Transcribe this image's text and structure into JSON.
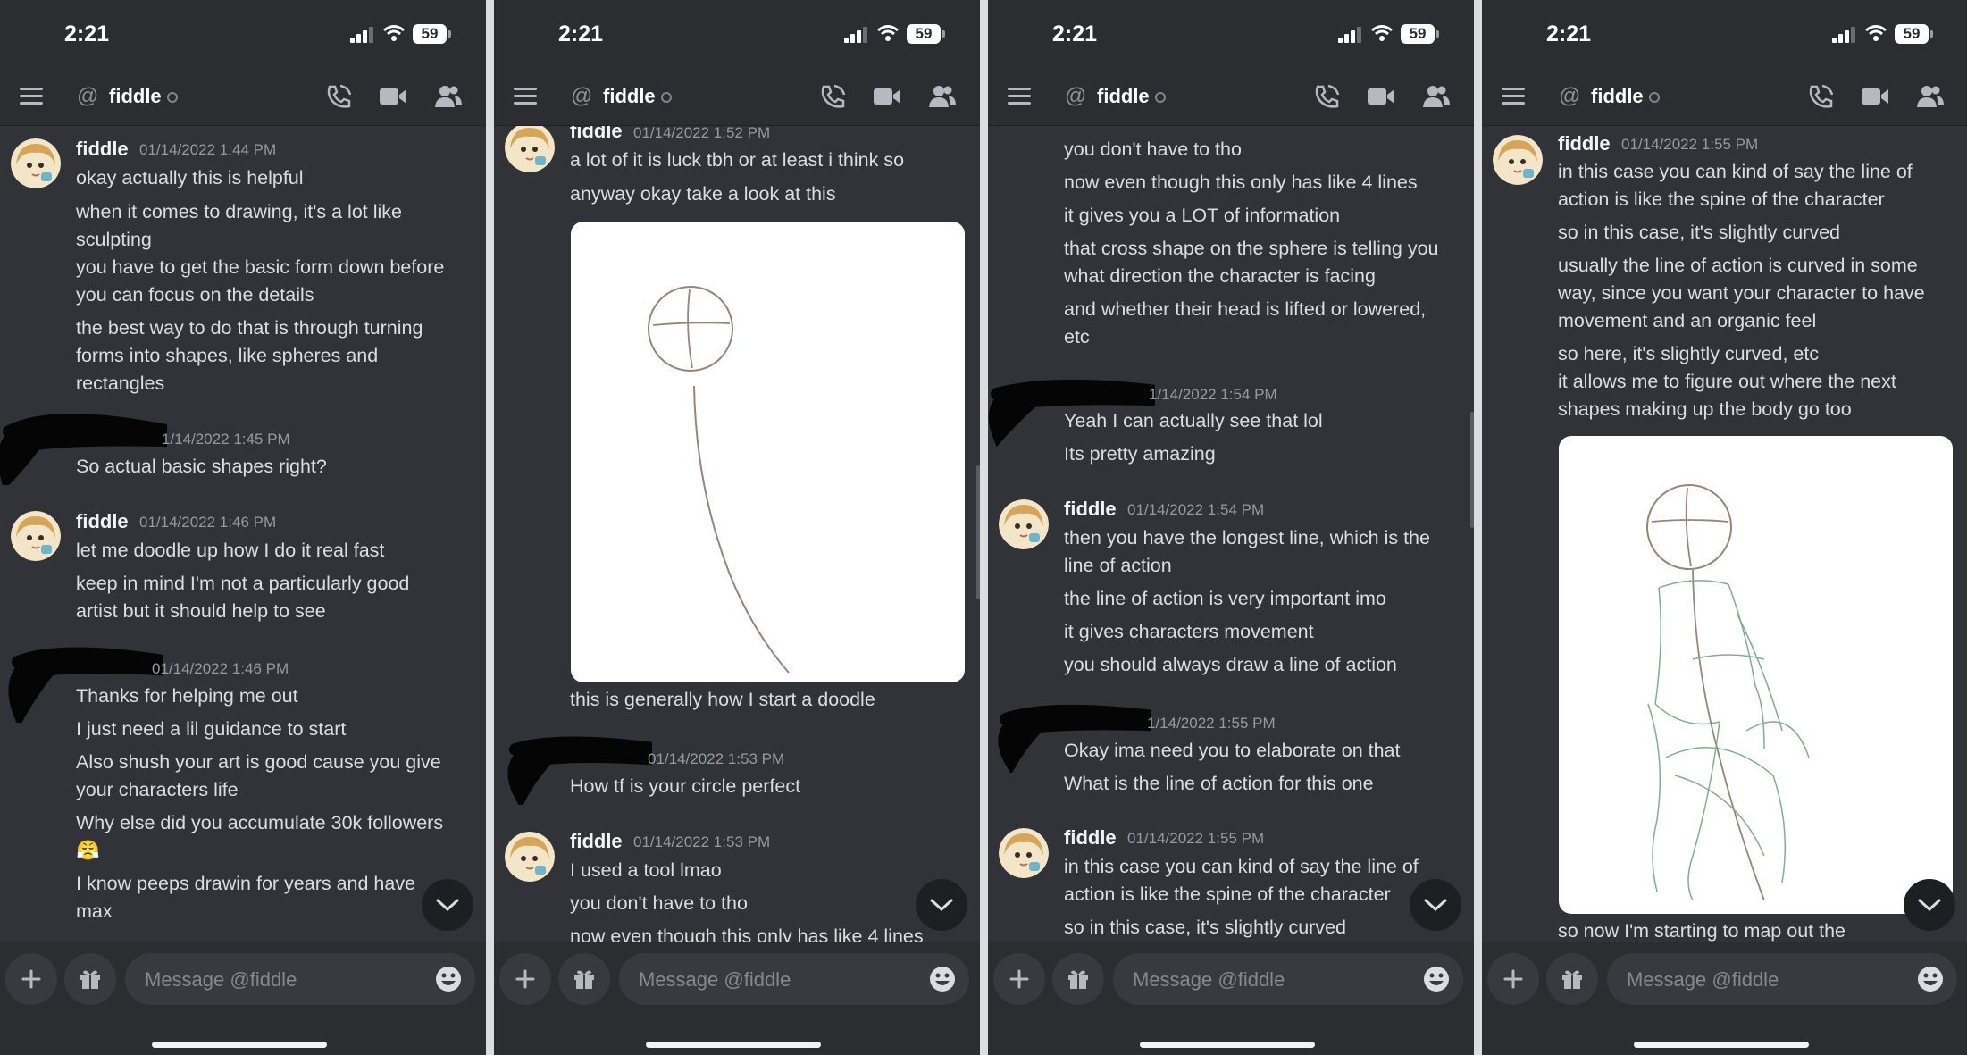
{
  "colors": {
    "background": "#313338",
    "bar": "#2b2d31",
    "text": "#dbdee1",
    "muted": "#949ba4"
  },
  "status_bar": {
    "time": "2:21",
    "battery": "59"
  },
  "header": {
    "at_symbol": "@",
    "name": "fiddle"
  },
  "composer": {
    "placeholder": "Message @fiddle"
  },
  "icons": [
    "hamburger-icon",
    "phone-icon",
    "video-icon",
    "members-icon",
    "plus-icon",
    "gift-icon",
    "emoji-icon",
    "chevron-down-icon"
  ],
  "panels": [
    {
      "groups": [
        {
          "author": "fiddle",
          "timestamp": "01/14/2022 1:44 PM",
          "lines": [
            "okay actually this is helpful",
            "when it comes to drawing, it's a lot like",
            "sculpting",
            "you have to get the basic form down before",
            "you can focus on the details",
            "the best way to do that is through turning",
            "forms into shapes, like spheres and",
            "rectangles"
          ]
        },
        {
          "author": "",
          "timestamp": "1/14/2022 1:45 PM",
          "lines": [
            "So actual basic shapes right?"
          ]
        },
        {
          "author": "fiddle",
          "timestamp": "01/14/2022 1:46 PM",
          "lines": [
            "let me doodle up how I do it real fast",
            "keep in mind I'm not a particularly good",
            "artist but it should help to see"
          ]
        },
        {
          "author": "",
          "timestamp": "01/14/2022 1:46 PM",
          "lines": [
            "Thanks for helping me out",
            "I just need a lil guidance to start",
            "Also shush your art is good cause you give",
            "your characters life",
            "Why else did you accumulate 30k followers",
            "😤",
            "I know peeps drawin for years and have",
            "max"
          ]
        }
      ]
    },
    {
      "groups": [
        {
          "author": "fiddle",
          "timestamp": "01/14/2022 1:52 PM",
          "lines": [
            "a lot of it is luck tbh or at least i think so",
            "anyway okay take a look at this",
            "this is generally how I start a doodle"
          ]
        },
        {
          "author": "",
          "timestamp": "01/14/2022 1:53 PM",
          "lines": [
            "How tf is your circle perfect"
          ]
        },
        {
          "author": "fiddle",
          "timestamp": "01/14/2022 1:53 PM",
          "lines": [
            "I used a tool lmao",
            "you don't have to tho",
            "now even though this only has like 4 lines"
          ]
        }
      ]
    },
    {
      "groups": [
        {
          "author": "",
          "timestamp": "",
          "lines": [
            "you don't have to tho",
            "now even though this only has like 4 lines",
            "it gives you a LOT of information",
            "that cross shape on the sphere is telling you",
            "what direction the character is facing",
            "and whether their head is lifted or lowered,",
            "etc"
          ]
        },
        {
          "author": "",
          "timestamp": "1/14/2022 1:54 PM",
          "lines": [
            "Yeah I can actually see that lol",
            "Its pretty amazing"
          ]
        },
        {
          "author": "fiddle",
          "timestamp": "01/14/2022 1:54 PM",
          "lines": [
            "then you have the longest line, which is the",
            "line of action",
            "the line of action is very important imo",
            "it gives characters movement",
            "you should always draw a line of action"
          ]
        },
        {
          "author": "",
          "timestamp": "1/14/2022 1:55 PM",
          "lines": [
            "Okay ima need you to elaborate on that",
            "What is the line of action for this one"
          ]
        },
        {
          "author": "fiddle",
          "timestamp": "01/14/2022 1:55 PM",
          "lines": [
            "in this case you can kind of say the line of",
            "action is like the spine of the character",
            "so in this case, it's slightly curved"
          ]
        }
      ]
    },
    {
      "groups": [
        {
          "author": "fiddle",
          "timestamp": "01/14/2022 1:55 PM",
          "lines": [
            "in this case you can kind of say the line of",
            "action is like the spine of the character",
            "so in this case, it's slightly curved",
            "usually the line of action is curved in some",
            "way, since you want your character to have",
            "movement and an organic feel",
            "so here, it's slightly curved, etc",
            "it allows me to figure out where the next",
            "shapes making up the body go too",
            "so now I'm starting to map out the"
          ]
        }
      ]
    }
  ]
}
